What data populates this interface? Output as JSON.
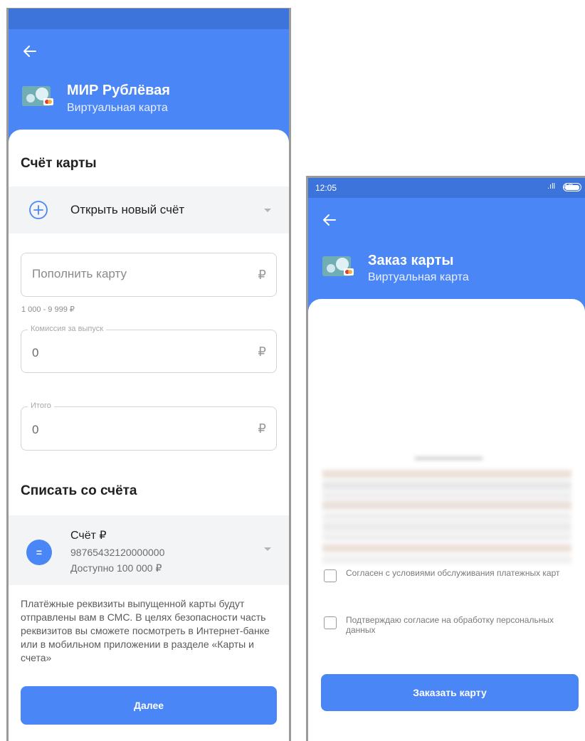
{
  "left_screen": {
    "header": {
      "title": "МИР Рублёвая",
      "subtitle": "Виртуальная карта"
    },
    "card_account": {
      "section_title": "Счёт карты",
      "open_new_label": "Открыть новый счёт"
    },
    "top_up": {
      "placeholder": "Пополнить карту",
      "currency": "₽",
      "range_hint": "1 000 - 9 999 ₽"
    },
    "commission": {
      "label": "Комиссия за выпуск",
      "value": "0",
      "currency": "₽"
    },
    "total": {
      "label": "Итого",
      "value": "0",
      "currency": "₽"
    },
    "debit": {
      "section_title": "Списать со счёта",
      "account_name": "Счёт ₽",
      "account_number": "98765432120000000",
      "available": "Доступно 100 000 ₽"
    },
    "info_text": "Платёжные реквизиты выпущенной карты будут отправлены вам в СМС. В целях безопасности часть реквизитов вы сможете посмотреть в Интернет-банке или в мобильном приложении в разделе «Карты и счета»",
    "next_button": "Далее"
  },
  "right_screen": {
    "status_bar": {
      "time": "12:05",
      "network": "4G"
    },
    "header": {
      "title": "Заказ карты",
      "subtitle": "Виртуальная карта"
    },
    "consents": [
      {
        "label": "Согласен с условиями обслуживания платежных карт",
        "checked": false
      },
      {
        "label": "Подтверждаю согласие на обработку персональных данных",
        "checked": false
      }
    ],
    "order_button": "Заказать карту"
  },
  "colors": {
    "accent": "#4a86f5",
    "status_bar": "#3d74dc"
  },
  "icons": [
    "back-arrow-icon",
    "card-icon",
    "plus-circle-icon",
    "chevron-down-icon",
    "account-icon",
    "signal-icon",
    "battery-icon"
  ]
}
